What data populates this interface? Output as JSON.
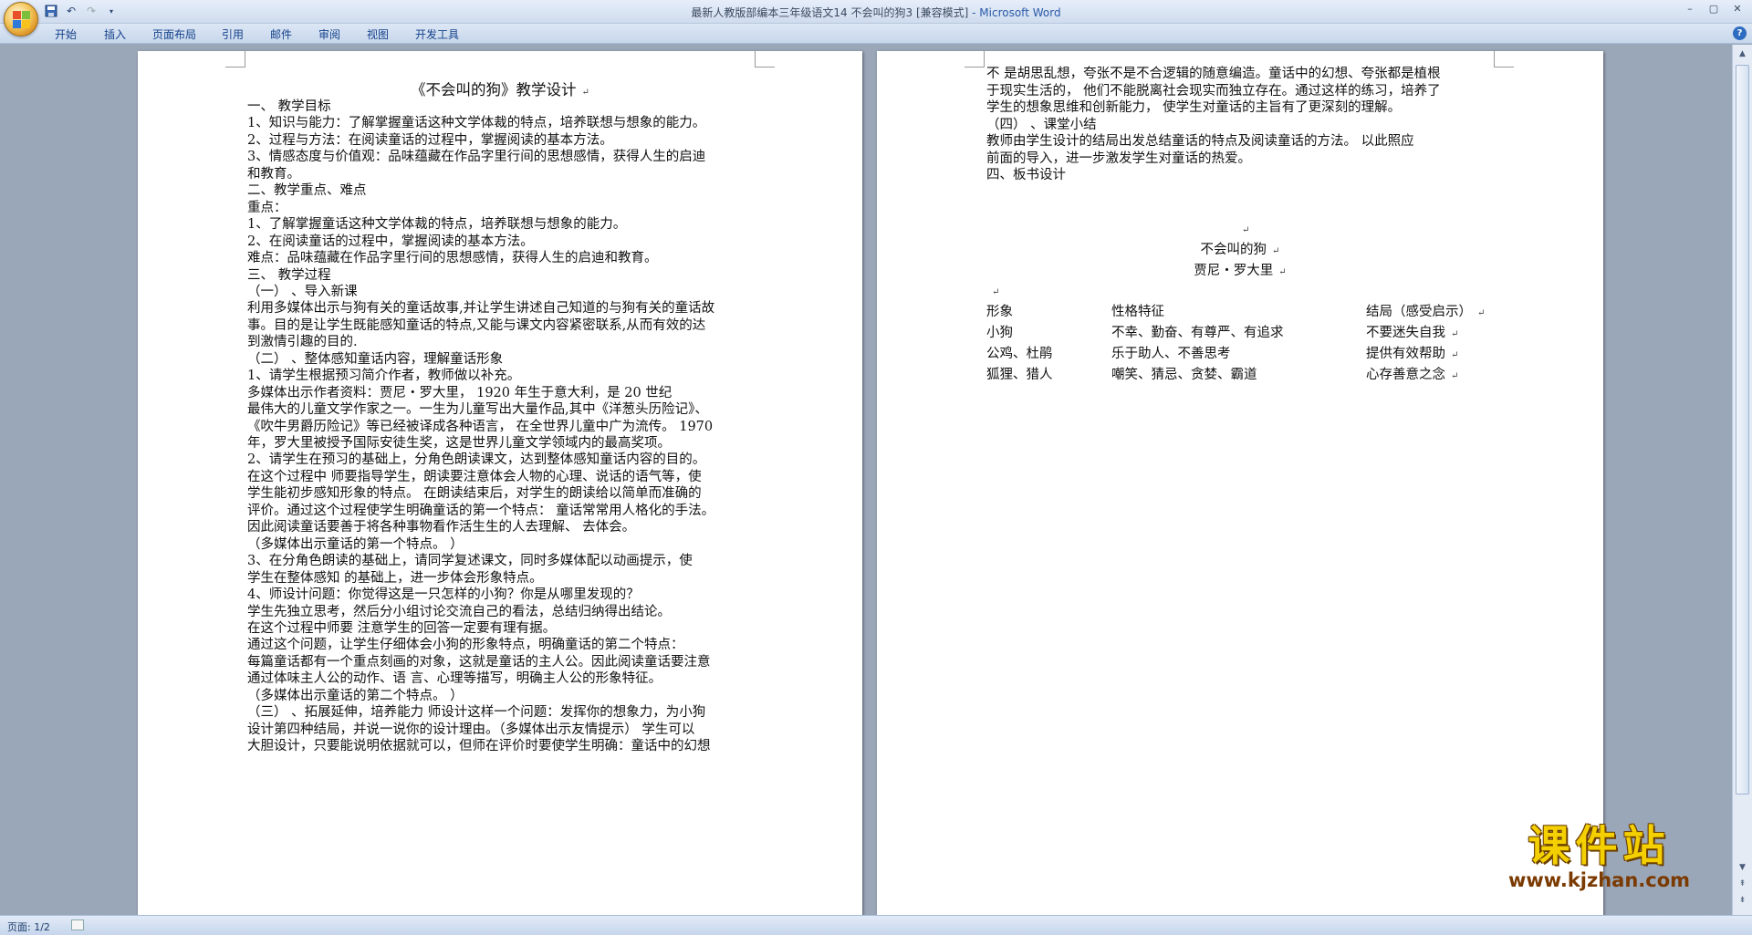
{
  "window": {
    "title": "最新人教版部编本三年级语文14 不会叫的狗3 [兼容模式]",
    "app_name": " - Microsoft Word",
    "controls": [
      "–",
      "▢",
      "✕"
    ]
  },
  "ribbon": {
    "tabs": [
      "开始",
      "插入",
      "页面布局",
      "引用",
      "邮件",
      "审阅",
      "视图",
      "开发工具"
    ],
    "help": "?"
  },
  "doc_left": {
    "title": "《不会叫的狗》教学设计",
    "lines": [
      "一、 教学目标",
      "1、知识与能力：了解掌握童话这种文学体裁的特点，培养联想与想象的能力。",
      "2、过程与方法：在阅读童话的过程中，掌握阅读的基本方法。",
      "3、情感态度与价值观：品味蕴藏在作品字里行间的思想感情，获得人生的启迪",
      "和教育。",
      "二、教学重点、难点",
      "  重点：",
      "1、了解掌握童话这种文学体裁的特点，培养联想与想象的能力。",
      "2、在阅读童话的过程中，掌握阅读的基本方法。",
      "  难点：品味蕴藏在作品字里行间的思想感情，获得人生的启迪和教育。",
      "三、 教学过程",
      "  （一） 、导入新课",
      "  利用多媒体出示与狗有关的童话故事,并让学生讲述自己知道的与狗有关的童话故",
      "事。目的是让学生既能感知童话的特点,又能与课文内容紧密联系,从而有效的达",
      "到激情引趣的目的.",
      "  （二） 、整体感知童话内容，理解童话形象",
      "  1、请学生根据预习简介作者，教师做以补充。",
      "    多媒体出示作者资料：贾尼・罗大里， 1920 年生于意大利，是 20 世纪",
      "最伟大的儿童文学作家之一。一生为儿童写出大量作品,其中《洋葱头历险记》、",
      "《吹牛男爵历险记》等已经被译成各种语言， 在全世界儿童中广为流传。 1970",
      "年，罗大里被授予国际安徒生奖，这是世界儿童文学领域内的最高奖项。",
      "  2、请学生在预习的基础上，分角色朗读课文，达到整体感知童话内容的目的。",
      "在这个过程中 师要指导学生，朗读要注意体会人物的心理、说话的语气等，使",
      "学生能初步感知形象的特点。 在朗读结束后，对学生的朗读给以简单而准确的",
      "评价。通过这个过程使学生明确童话的第一个特点： 童话常常用人格化的手法。",
      "因此阅读童话要善于将各种事物看作活生生的人去理解、 去体会。",
      "  （多媒体出示童话的第一个特点。 ）",
      "  3、在分角色朗读的基础上，请同学复述课文，同时多媒体配以动画提示，使",
      "学生在整体感知 的基础上，进一步体会形象特点。",
      "  4、师设计问题：你觉得这是一只怎样的小狗？你是从哪里发现的？",
      "    学生先独立思考，然后分小组讨论交流自己的看法，总结归纳得出结论。",
      "    在这个过程中师要 注意学生的回答一定要有理有据。",
      "    通过这个问题，让学生仔细体会小狗的形象特点，明确童话的第二个特点：",
      "每篇童话都有一个重点刻画的对象，这就是童话的主人公。因此阅读童话要注意",
      "通过体味主人公的动作、语 言、心理等描写，明确主人公的形象特征。",
      "     （多媒体出示童话的第二个特点。 ）",
      "（三） 、拓展延伸，培养能力 师设计这样一个问题：发挥你的想象力，为小狗",
      "设计第四种结局，并说一说你的设计理由。（多媒体出示友情提示） 学生可以",
      "大胆设计，只要能说明依据就可以，但师在评价时要使学生明确：童话中的幻想"
    ]
  },
  "doc_right": {
    "lines": [
      "不 是胡思乱想，夸张不是不合逻辑的随意编造。童话中的幻想、夸张都是植根",
      "于现实生活的，   他们不能脱离社会现实而独立存在。通过这样的练习，培养了",
      "学生的想象思维和创新能力， 使学生对童话的主旨有了更深刻的理解。",
      "（四）  、课堂小结",
      "    教师由学生设计的结局出发总结童话的特点及阅读童话的方法。 以此照应",
      "前面的导入，进一步激发学生对童话的热爱。",
      "四、板书设计"
    ],
    "board_title": "不会叫的狗",
    "board_author": "贾尼・罗大里",
    "table_headers": [
      "形象",
      "性格特征",
      "结局（感受启示）"
    ],
    "table_rows": [
      [
        "小狗",
        "不幸、勤奋、有尊严、有追求",
        "不要迷失自我"
      ],
      [
        "公鸡、杜鹃",
        "乐于助人、不善思考",
        "提供有效帮助"
      ],
      [
        "狐狸、猎人",
        "嘲笑、猜忌、贪婪、霸道",
        "心存善意之念"
      ]
    ]
  },
  "status": {
    "page_info": "页面: 1/2"
  },
  "watermark": {
    "big": "课件站",
    "url": "www.kjzhan.com"
  },
  "colors": {
    "workspace": "#9aa7b8",
    "ribbon_text": "#15428b",
    "accent": "#2a5aa8"
  }
}
